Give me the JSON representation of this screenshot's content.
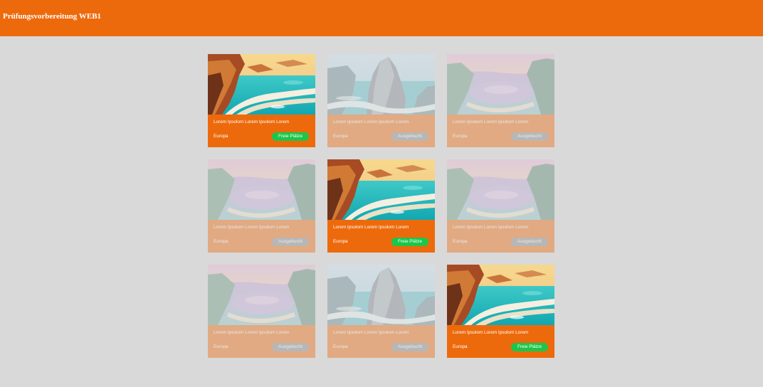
{
  "header": {
    "title": "Prüfungsvorbereitung WEB1"
  },
  "colors": {
    "header": "#ed6a0c",
    "page_background": "#d9d9d9",
    "card_background": "#ed6a0c",
    "badge_free": "#1bc64a",
    "badge_booked": "#8a8a8a"
  },
  "cards": [
    {
      "image": "coastline-cliffs-image",
      "title": "Lorem Ipsolom Lorem Ipsolom Lorem",
      "region": "Europa",
      "status": "Freie Plätze",
      "available": true
    },
    {
      "image": "sea-stack-image",
      "title": "Lorem Ipsolom Lorem Ipsolom Lorem",
      "region": "Europa",
      "status": "Ausgebucht",
      "available": false
    },
    {
      "image": "bay-sunset-image",
      "title": "Lorem Ipsolom Lorem Ipsolom Lorem",
      "region": "Europa",
      "status": "Ausgebucht",
      "available": false
    },
    {
      "image": "bay-sunset-image",
      "title": "Lorem Ipsolom Lorem Ipsolom Lorem",
      "region": "Europa",
      "status": "Ausgebucht",
      "available": false
    },
    {
      "image": "coastline-cliffs-image",
      "title": "Lorem Ipsolom Lorem Ipsolom Lorem",
      "region": "Europa",
      "status": "Freie Plätze",
      "available": true
    },
    {
      "image": "bay-sunset-image",
      "title": "Lorem Ipsolom Lorem Ipsolom Lorem",
      "region": "Europa",
      "status": "Ausgebucht",
      "available": false
    },
    {
      "image": "bay-sunset-image",
      "title": "Lorem Ipsolom Lorem Ipsolom Lorem",
      "region": "Europa",
      "status": "Ausgebucht",
      "available": false
    },
    {
      "image": "sea-stack-image",
      "title": "Lorem Ipsolom Lorem Ipsolom Lorem",
      "region": "Europa",
      "status": "Ausgebucht",
      "available": false
    },
    {
      "image": "coastline-cliffs-image",
      "title": "Lorem Ipsolom Lorem Ipsolom Lorem",
      "region": "Europa",
      "status": "Freie Plätze",
      "available": true
    }
  ]
}
